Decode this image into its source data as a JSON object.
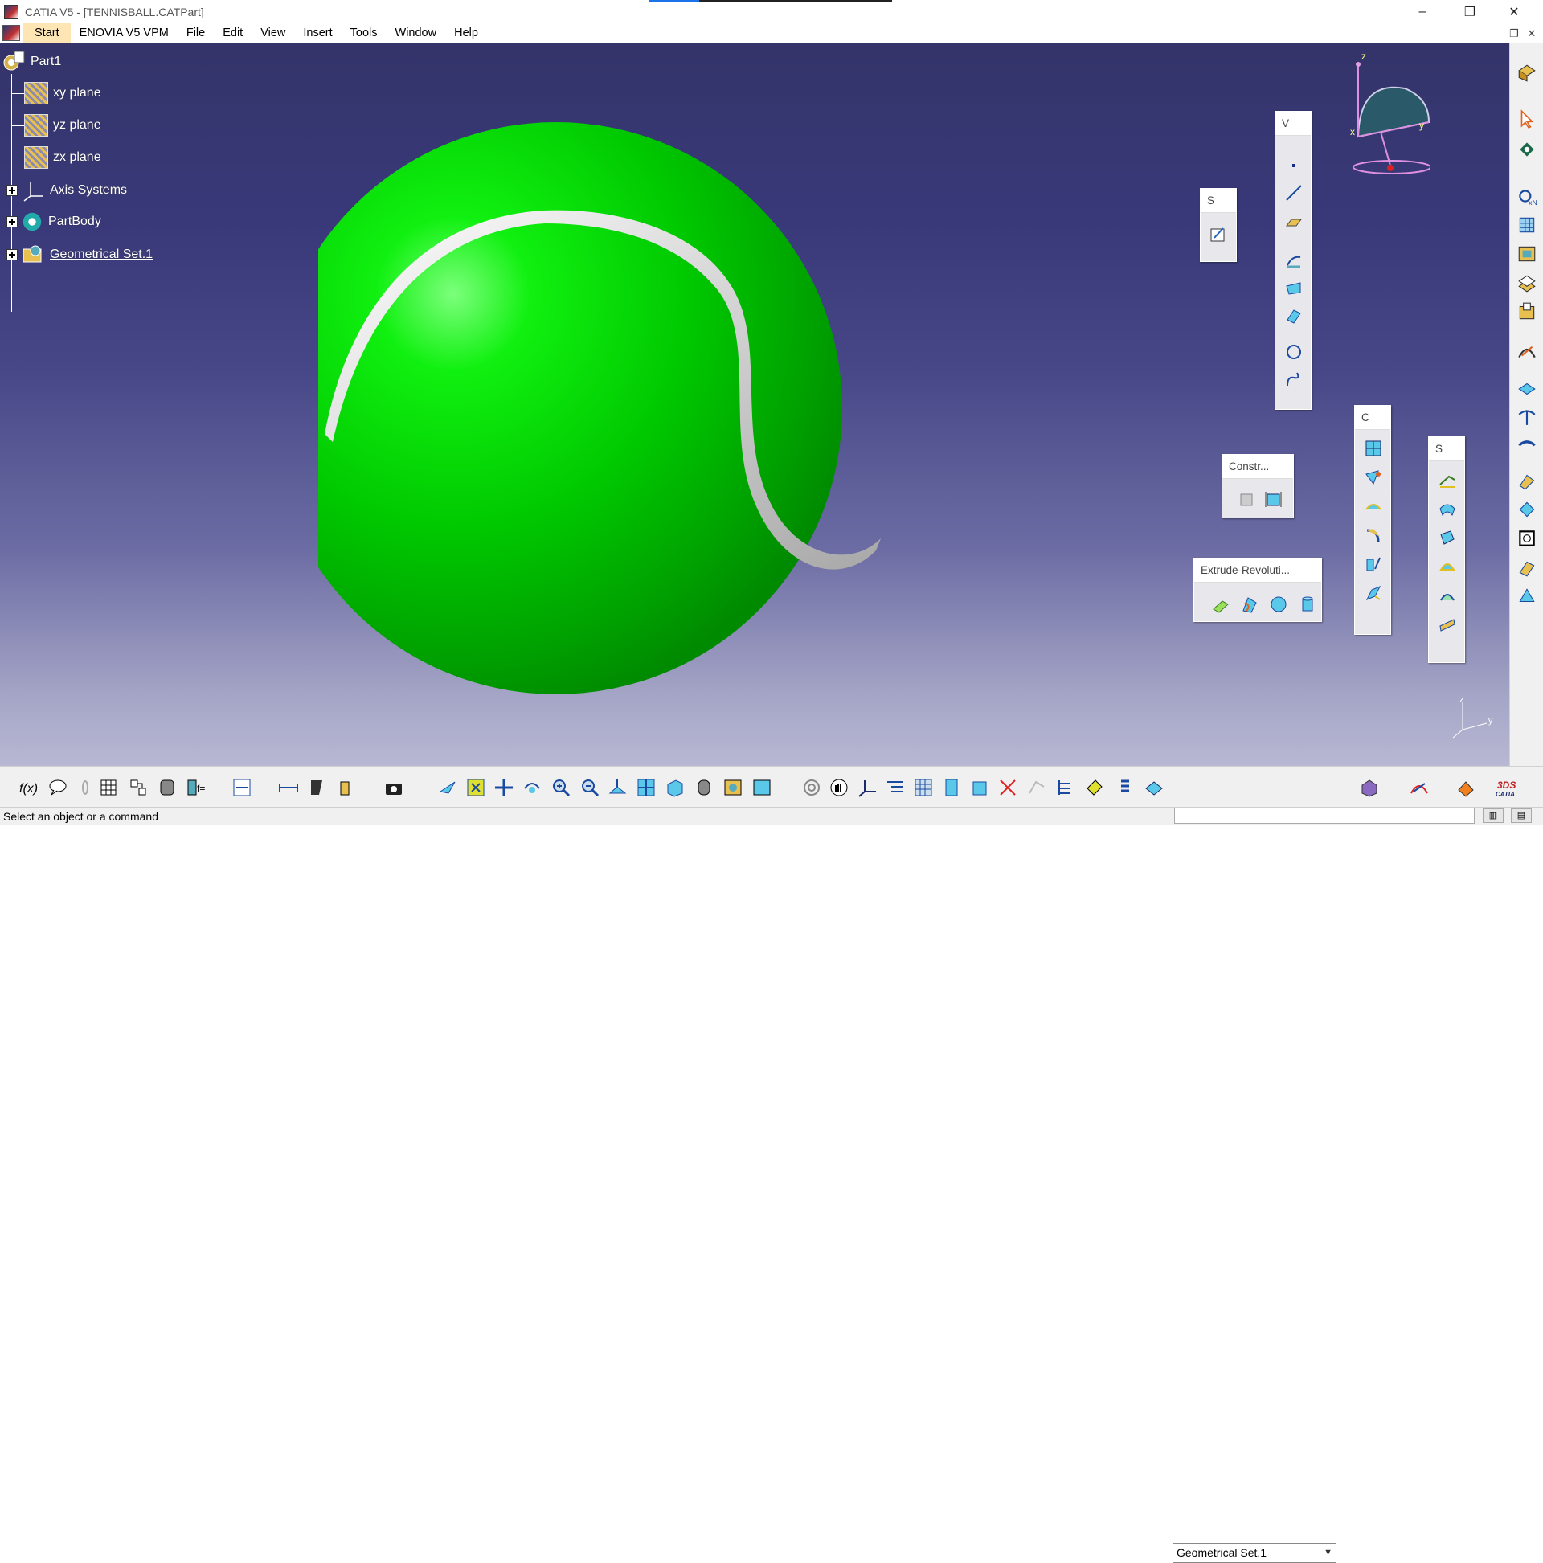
{
  "window": {
    "title": "CATIA V5 - [TENNISBALL.CATPart]",
    "controls": [
      "minimize",
      "restore",
      "close"
    ]
  },
  "menu": {
    "items": [
      {
        "label": "Start"
      },
      {
        "label": "ENOVIA V5 VPM"
      },
      {
        "label": "File"
      },
      {
        "label": "Edit"
      },
      {
        "label": "View"
      },
      {
        "label": "Insert"
      },
      {
        "label": "Tools"
      },
      {
        "label": "Window"
      },
      {
        "label": "Help"
      }
    ]
  },
  "tree": {
    "root": "Part1",
    "items": [
      {
        "label": "xy plane",
        "icon": "plane-icon"
      },
      {
        "label": "yz plane",
        "icon": "plane-icon"
      },
      {
        "label": "zx plane",
        "icon": "plane-icon"
      },
      {
        "label": "Axis Systems",
        "icon": "axis-systems-icon"
      },
      {
        "label": "PartBody",
        "icon": "part-body-icon"
      },
      {
        "label": "Geometrical Set.1",
        "icon": "geometrical-set-icon"
      }
    ]
  },
  "floating_toolbars": {
    "sketcher": {
      "title": "S"
    },
    "wireframe": {
      "title": "V"
    },
    "constraints": {
      "title": "Constr..."
    },
    "extrude_revolution": {
      "title": "Extrude-Revoluti..."
    },
    "operations": {
      "title": "C"
    },
    "surfaces": {
      "title": "S"
    }
  },
  "compass": {
    "x_label": "x",
    "y_label": "y",
    "z_label": "z"
  },
  "axis_triad": {
    "z_label": "z",
    "y_label": "y"
  },
  "bottom_toolbar": {
    "current_set": "Geometrical Set.1"
  },
  "status_bar": {
    "message": "Select an object or a command"
  },
  "colors": {
    "viewport_top": "#34346a",
    "viewport_bottom": "#b8b8d4",
    "ball_green": "#00d000",
    "seam": "#c8c8c8",
    "start_highlight": "#fde6b4"
  }
}
